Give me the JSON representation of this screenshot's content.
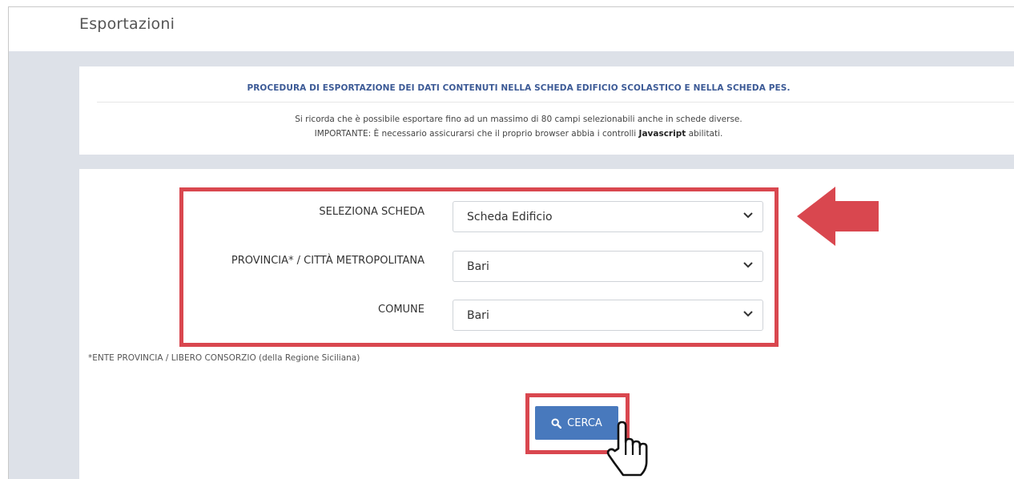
{
  "page": {
    "title": "Esportazioni"
  },
  "info": {
    "heading": "PROCEDURA DI ESPORTAZIONE DEI DATI CONTENUTI NELLA SCHEDA EDIFICIO SCOLASTICO E NELLA SCHEDA PES.",
    "line1": "Si ricorda che è possibile esportare fino ad un massimo di 80 campi selezionabili anche in schede diverse.",
    "line2_prefix": "IMPORTANTE: È necessario assicurarsi che il proprio browser abbia i controlli ",
    "line2_bold": "Javascript",
    "line2_suffix": " abilitati."
  },
  "form": {
    "scheda_label": "SELEZIONA SCHEDA",
    "scheda_value": "Scheda Edificio",
    "provincia_label": "PROVINCIA* / CITTÀ METROPOLITANA",
    "provincia_value": "Bari",
    "comune_label": "COMUNE",
    "comune_value": "Bari",
    "footnote": "*ENTE PROVINCIA / LIBERO CONSORZIO (della Regione Siciliana)"
  },
  "actions": {
    "cerca_label": "CERCA"
  },
  "icons": {
    "chevron": "chevron-down-icon",
    "search": "search-icon",
    "arrow": "arrow-left-icon",
    "cursor": "hand-pointer-icon"
  },
  "colors": {
    "highlight": "#d9474f",
    "button": "#4879bd",
    "heading": "#3c5a96",
    "background": "#dde1e8"
  }
}
